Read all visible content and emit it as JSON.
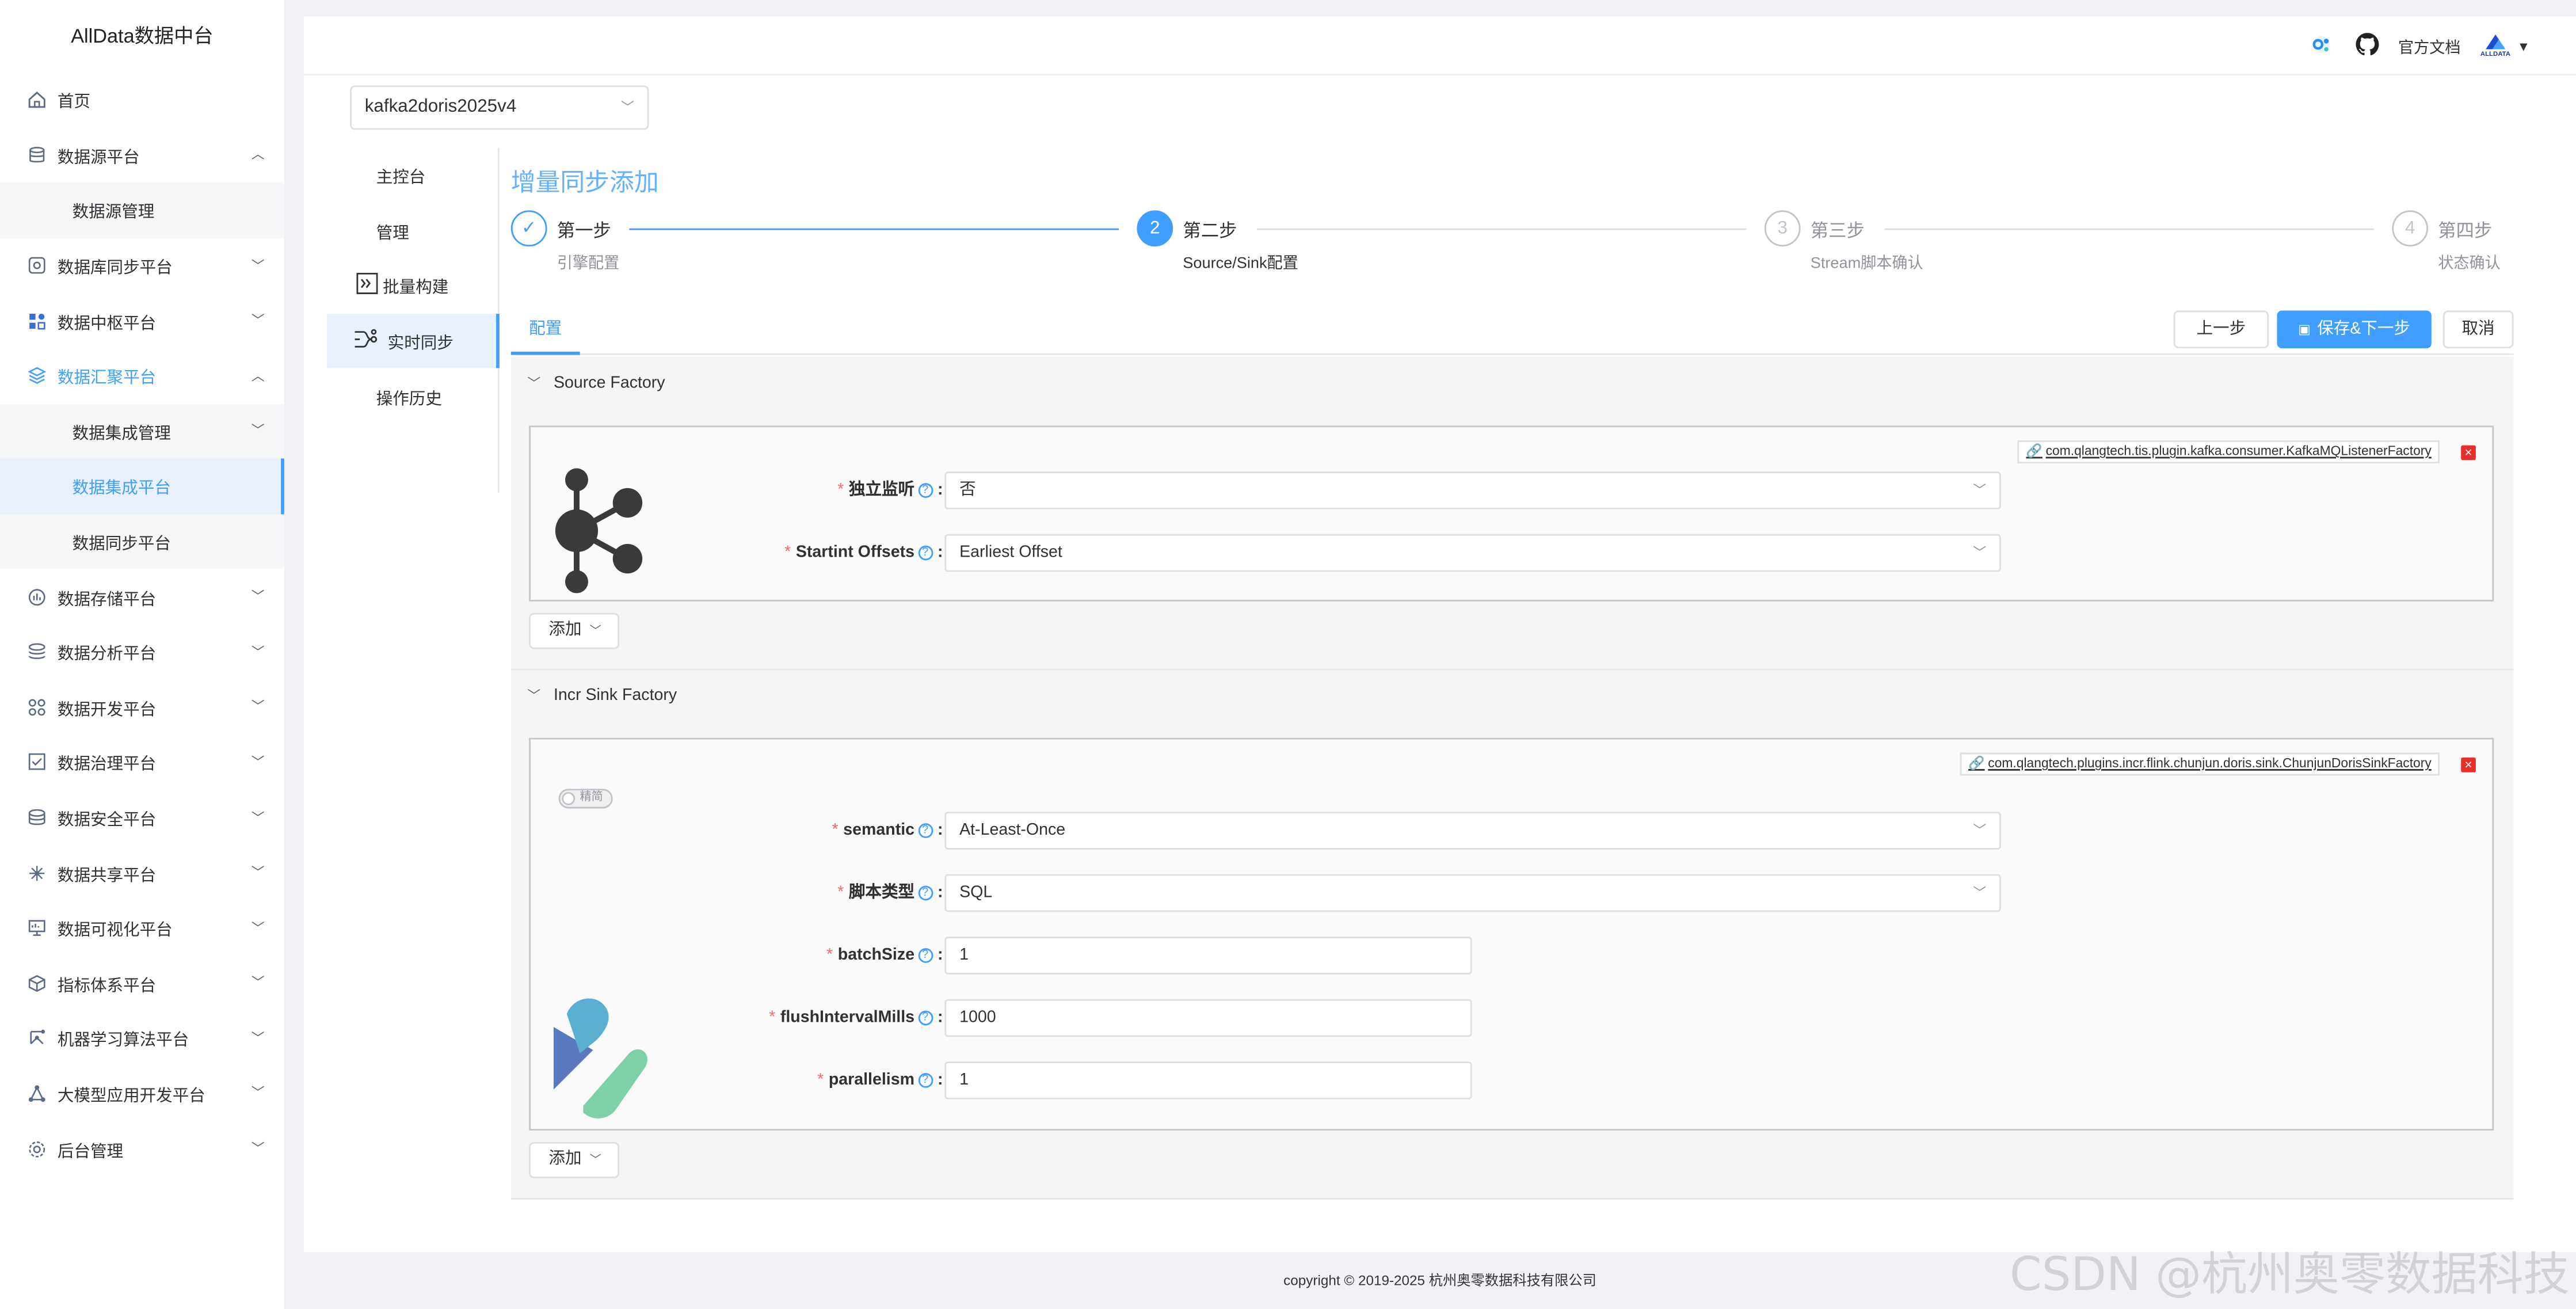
{
  "app": {
    "title": "AllData数据中台"
  },
  "sidebar": {
    "items": [
      {
        "label": "首页",
        "icon": "home-icon"
      },
      {
        "label": "数据源平台",
        "icon": "database-icon"
      },
      {
        "label": "数据源管理"
      },
      {
        "label": "数据库同步平台",
        "icon": "db-sync-icon"
      },
      {
        "label": "数据中枢平台",
        "icon": "hub-icon"
      },
      {
        "label": "数据汇聚平台",
        "icon": "layers-icon"
      },
      {
        "label": "数据集成管理"
      },
      {
        "label": "数据集成平台"
      },
      {
        "label": "数据同步平台"
      },
      {
        "label": "数据存储平台",
        "icon": "storage-icon"
      },
      {
        "label": "数据分析平台",
        "icon": "analysis-icon"
      },
      {
        "label": "数据开发平台",
        "icon": "dev-icon"
      },
      {
        "label": "数据治理平台",
        "icon": "governance-icon"
      },
      {
        "label": "数据安全平台",
        "icon": "security-icon"
      },
      {
        "label": "数据共享平台",
        "icon": "share-icon"
      },
      {
        "label": "数据可视化平台",
        "icon": "visual-icon"
      },
      {
        "label": "指标体系平台",
        "icon": "metrics-icon"
      },
      {
        "label": "机器学习算法平台",
        "icon": "ml-icon"
      },
      {
        "label": "大模型应用开发平台",
        "icon": "llm-icon"
      },
      {
        "label": "后台管理",
        "icon": "admin-icon"
      }
    ]
  },
  "header": {
    "docs_label": "官方文档",
    "brand": "ALLDATA"
  },
  "pipeline": {
    "selected": "kafka2doris2025v4"
  },
  "subnav": {
    "items": [
      "主控台",
      "管理",
      "批量构建",
      "实时同步",
      "操作历史"
    ]
  },
  "page": {
    "title": "增量同步添加"
  },
  "steps": [
    {
      "num": "1",
      "title": "第一步",
      "desc": "引擎配置"
    },
    {
      "num": "2",
      "title": "第二步",
      "desc": "Source/Sink配置"
    },
    {
      "num": "3",
      "title": "第三步",
      "desc": "Stream脚本确认"
    },
    {
      "num": "4",
      "title": "第四步",
      "desc": "状态确认"
    }
  ],
  "tabs": {
    "config": "配置"
  },
  "actions": {
    "prev": "上一步",
    "save_next": "保存&下一步",
    "cancel": "取消"
  },
  "source": {
    "header": "Source Factory",
    "plugin": "com.qlangtech.tis.plugin.kafka.consumer.KafkaMQListenerFactory",
    "fields": [
      {
        "label": "独立监听",
        "value": "否"
      },
      {
        "label": "Startint Offsets",
        "value": "Earliest Offset"
      }
    ],
    "add_label": "添加"
  },
  "sink": {
    "header": "Incr Sink Factory",
    "plugin": "com.qlangtech.plugins.incr.flink.chunjun.doris.sink.ChunjunDorisSinkFactory",
    "toggle_label": "精简",
    "fields": [
      {
        "label": "semantic",
        "value": "At-Least-Once"
      },
      {
        "label": "脚本类型",
        "value": "SQL"
      },
      {
        "label": "batchSize",
        "value": "1"
      },
      {
        "label": "flushIntervalMills",
        "value": "1000"
      },
      {
        "label": "parallelism",
        "value": "1"
      }
    ],
    "add_label": "添加"
  },
  "footer": {
    "copyright": "copyright © 2019-2025 杭州奥零数据科技有限公司"
  },
  "watermark": "CSDN @杭州奥零数据科技",
  "colors": {
    "primary": "#409eff",
    "title": "#66b1ff",
    "required": "#f56c6c",
    "delete": "#e8302a"
  }
}
